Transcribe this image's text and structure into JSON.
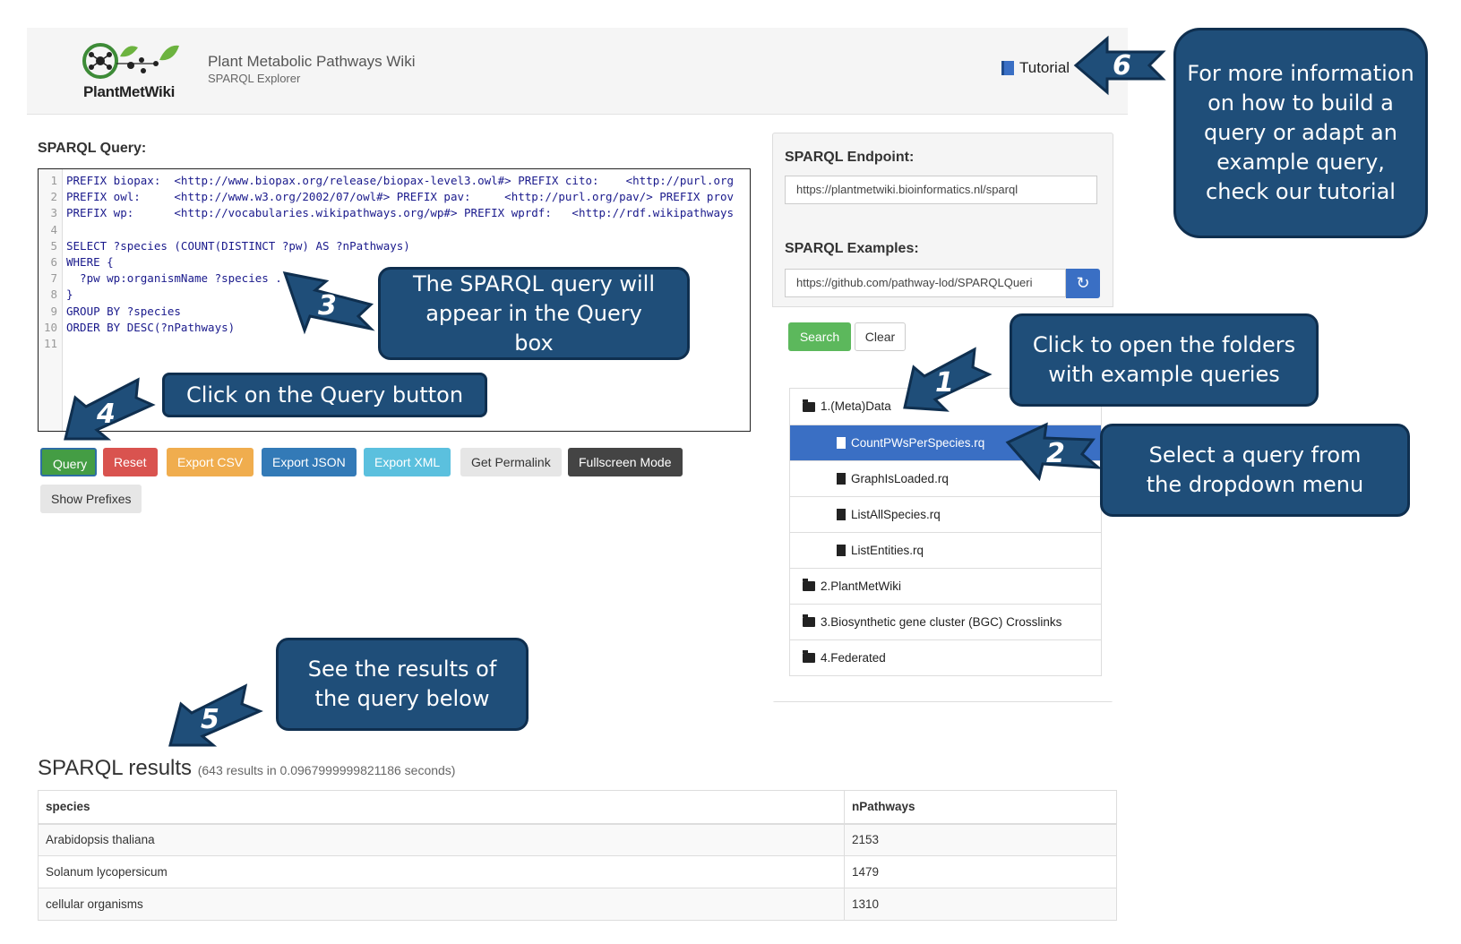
{
  "header": {
    "logo_text": "PlantMetWiki",
    "title": "Plant Metabolic Pathways Wiki",
    "subtitle": "SPARQL Explorer",
    "tutorial_label": "Tutorial"
  },
  "query": {
    "label": "SPARQL Query:",
    "lines": [
      {
        "n": "1",
        "text": "PREFIX biopax:  <http://www.biopax.org/release/biopax-level3.owl#> PREFIX cito:    <http://purl.org"
      },
      {
        "n": "2",
        "text": "PREFIX owl:     <http://www.w3.org/2002/07/owl#> PREFIX pav:     <http://purl.org/pav/> PREFIX prov"
      },
      {
        "n": "3",
        "text": "PREFIX wp:      <http://vocabularies.wikipathways.org/wp#> PREFIX wprdf:   <http://rdf.wikipathways"
      },
      {
        "n": "4",
        "text": ""
      },
      {
        "n": "5",
        "text": "SELECT ?species (COUNT(DISTINCT ?pw) AS ?nPathways)"
      },
      {
        "n": "6",
        "text": "WHERE {"
      },
      {
        "n": "7",
        "text": "  ?pw wp:organismName ?species ."
      },
      {
        "n": "8",
        "text": "}"
      },
      {
        "n": "9",
        "text": "GROUP BY ?species"
      },
      {
        "n": "10",
        "text": "ORDER BY DESC(?nPathways)"
      },
      {
        "n": "11",
        "text": ""
      }
    ],
    "buttons": {
      "query": "Query",
      "reset": "Reset",
      "export_csv": "Export CSV",
      "export_json": "Export JSON",
      "export_xml": "Export XML",
      "permalink": "Get Permalink",
      "fullscreen": "Fullscreen Mode",
      "show_prefixes": "Show Prefixes"
    }
  },
  "panel": {
    "endpoint_label": "SPARQL Endpoint:",
    "endpoint_value": "https://plantmetwiki.bioinformatics.nl/sparql",
    "examples_label": "SPARQL Examples:",
    "examples_value": "https://github.com/pathway-lod/SPARQLQueri",
    "search_label": "Search",
    "clear_label": "Clear",
    "tree": [
      {
        "label": "1.(Meta)Data",
        "type": "folder-open",
        "indent": false
      },
      {
        "label": "CountPWsPerSpecies.rq",
        "type": "file",
        "indent": true,
        "active": true
      },
      {
        "label": "GraphIsLoaded.rq",
        "type": "file",
        "indent": true
      },
      {
        "label": "ListAllSpecies.rq",
        "type": "file",
        "indent": true
      },
      {
        "label": "ListEntities.rq",
        "type": "file",
        "indent": true
      },
      {
        "label": "2.PlantMetWiki",
        "type": "folder",
        "indent": false
      },
      {
        "label": "3.Biosynthetic gene cluster (BGC) Crosslinks",
        "type": "folder",
        "indent": false
      },
      {
        "label": "4.Federated",
        "type": "folder",
        "indent": false
      }
    ]
  },
  "results": {
    "title": "SPARQL results",
    "meta": "(643 results in 0.0967999999821186 seconds)",
    "columns": [
      "species",
      "nPathways"
    ],
    "rows": [
      [
        "Arabidopsis thaliana",
        "2153"
      ],
      [
        "Solanum lycopersicum",
        "1479"
      ],
      [
        "cellular organisms",
        "1310"
      ]
    ]
  },
  "callouts": {
    "c1": "Click to open the folders with example queries",
    "c2": "Select a query from the dropdown menu",
    "c3": "The SPARQL query will appear in the Query box",
    "c4": "Click on the Query button",
    "c5": "See the results of the query below",
    "c6": "For more information on how to build a query or adapt an example query, check our tutorial"
  },
  "arrow_numbers": [
    "1",
    "2",
    "3",
    "4",
    "5",
    "6"
  ],
  "colors": {
    "callout_bg": "#1f4e79",
    "query_green": "#449d44",
    "reset_red": "#d9534f",
    "csv_orange": "#f0ad4e",
    "json_blue": "#337ab7",
    "xml_cyan": "#5bc0de",
    "active_blue": "#3a6fc4"
  }
}
